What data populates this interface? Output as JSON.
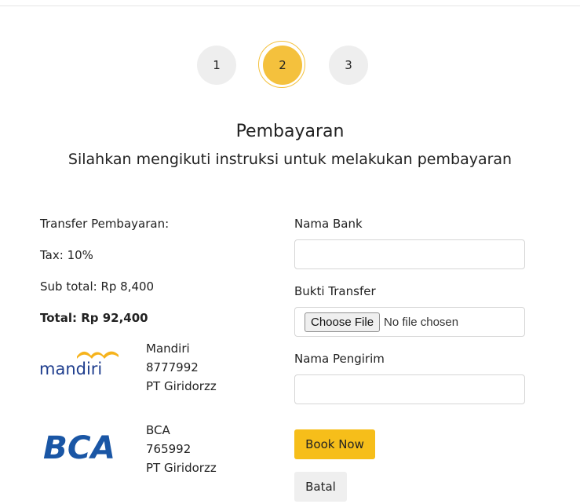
{
  "steps": [
    {
      "label": "1",
      "active": false
    },
    {
      "label": "2",
      "active": true
    },
    {
      "label": "3",
      "active": false
    }
  ],
  "header": {
    "title": "Pembayaran",
    "subtitle": "Silahkan mengikuti instruksi untuk melakukan pembayaran"
  },
  "summary": {
    "transfer_label": "Transfer Pembayaran:",
    "tax": "Tax: 10%",
    "subtotal": "Sub total: Rp 8,400",
    "total": "Total: Rp 92,400"
  },
  "banks": [
    {
      "logo": "mandiri-logo",
      "name": "Mandiri",
      "account": "8777992",
      "holder": "PT Giridorzz"
    },
    {
      "logo": "bca-logo",
      "name": "BCA",
      "account": "765992",
      "holder": "PT Giridorzz"
    }
  ],
  "form": {
    "bank_name_label": "Nama Bank",
    "bank_name_value": "",
    "proof_label": "Bukti Transfer",
    "choose_file_label": "Choose File",
    "no_file_text": "No file chosen",
    "sender_label": "Nama Pengirim",
    "sender_value": "",
    "book_button": "Book Now",
    "cancel_button": "Batal"
  },
  "colors": {
    "accent": "#f6be1a",
    "step_active": "#f4c13d",
    "step_inactive": "#eeeeee",
    "mandiri_blue": "#1f3e8e",
    "mandiri_gold": "#f6b31c",
    "bca_blue": "#1a56a5"
  }
}
